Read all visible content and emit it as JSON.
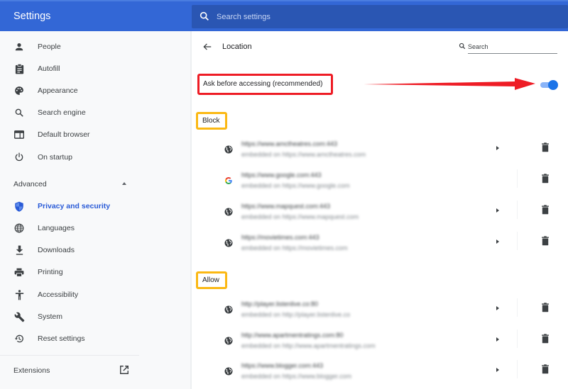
{
  "header": {
    "title": "Settings",
    "search_placeholder": "Search settings"
  },
  "sidebar": {
    "items": [
      {
        "label": "People",
        "icon": "person-icon"
      },
      {
        "label": "Autofill",
        "icon": "clipboard-icon"
      },
      {
        "label": "Appearance",
        "icon": "palette-icon"
      },
      {
        "label": "Search engine",
        "icon": "search-icon"
      },
      {
        "label": "Default browser",
        "icon": "browser-window-icon"
      },
      {
        "label": "On startup",
        "icon": "power-icon"
      }
    ],
    "advanced_label": "Advanced",
    "advanced_items": [
      {
        "label": "Privacy and security",
        "icon": "shield-icon",
        "active": true
      },
      {
        "label": "Languages",
        "icon": "globe-icon"
      },
      {
        "label": "Downloads",
        "icon": "download-icon"
      },
      {
        "label": "Printing",
        "icon": "printer-icon"
      },
      {
        "label": "Accessibility",
        "icon": "accessibility-icon"
      },
      {
        "label": "System",
        "icon": "wrench-icon"
      },
      {
        "label": "Reset settings",
        "icon": "history-icon"
      }
    ],
    "extensions_label": "Extensions"
  },
  "main": {
    "page_title": "Location",
    "search_placeholder": "Search",
    "ask_label": "Ask before accessing (recommended)",
    "ask_enabled": true,
    "block": {
      "label": "Block",
      "sites": [
        {
          "url": "https://www.amctheatres.com:443",
          "embedded": "embedded on https://www.amctheatres.com",
          "icon": "globe-icon",
          "has_arrow": true
        },
        {
          "url": "https://www.google.com:443",
          "embedded": "embedded on https://www.google.com",
          "icon": "google-icon",
          "has_arrow": false
        },
        {
          "url": "https://www.mapquest.com:443",
          "embedded": "embedded on https://www.mapquest.com",
          "icon": "globe-icon",
          "has_arrow": true
        },
        {
          "url": "https://movietimes.com:443",
          "embedded": "embedded on https://movietimes.com",
          "icon": "globe-icon",
          "has_arrow": true
        }
      ]
    },
    "allow": {
      "label": "Allow",
      "sites": [
        {
          "url": "http://player.listenlive.co:80",
          "embedded": "embedded on http://player.listenlive.co",
          "icon": "globe-icon",
          "has_arrow": true
        },
        {
          "url": "http://www.apartmentratings.com:80",
          "embedded": "embedded on http://www.apartmentratings.com",
          "icon": "globe-icon",
          "has_arrow": true
        },
        {
          "url": "https://www.blogger.com:443",
          "embedded": "embedded on https://www.blogger.com",
          "icon": "globe-icon",
          "has_arrow": true
        }
      ]
    }
  },
  "colors": {
    "header": "#3367d6",
    "accent": "#1a73e8",
    "annotation_red": "#ee1c25",
    "annotation_yellow": "#fbb813"
  }
}
